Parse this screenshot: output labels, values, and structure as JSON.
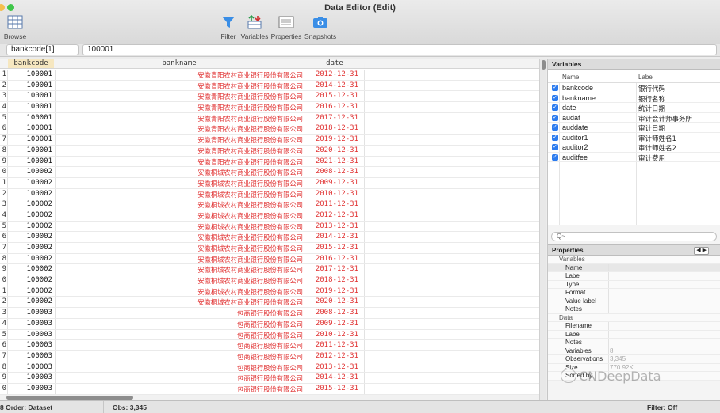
{
  "window": {
    "title": "Data Editor (Edit)"
  },
  "toolbar": {
    "browse": "Browse",
    "filter": "Filter",
    "variables": "Variables",
    "properties": "Properties",
    "snapshots": "Snapshots"
  },
  "cellbar": {
    "ref": "bankcode[1]",
    "value": "100001"
  },
  "grid": {
    "columns": {
      "bankcode": "bankcode",
      "bankname": "bankname",
      "date": "date"
    },
    "rows": [
      {
        "n": "1",
        "code": "100001",
        "name": "安徽青阳农村商业银行股份有限公司",
        "date": "2012-12-31"
      },
      {
        "n": "2",
        "code": "100001",
        "name": "安徽青阳农村商业银行股份有限公司",
        "date": "2014-12-31"
      },
      {
        "n": "3",
        "code": "100001",
        "name": "安徽青阳农村商业银行股份有限公司",
        "date": "2015-12-31"
      },
      {
        "n": "4",
        "code": "100001",
        "name": "安徽青阳农村商业银行股份有限公司",
        "date": "2016-12-31"
      },
      {
        "n": "5",
        "code": "100001",
        "name": "安徽青阳农村商业银行股份有限公司",
        "date": "2017-12-31"
      },
      {
        "n": "6",
        "code": "100001",
        "name": "安徽青阳农村商业银行股份有限公司",
        "date": "2018-12-31"
      },
      {
        "n": "7",
        "code": "100001",
        "name": "安徽青阳农村商业银行股份有限公司",
        "date": "2019-12-31"
      },
      {
        "n": "8",
        "code": "100001",
        "name": "安徽青阳农村商业银行股份有限公司",
        "date": "2020-12-31"
      },
      {
        "n": "9",
        "code": "100001",
        "name": "安徽青阳农村商业银行股份有限公司",
        "date": "2021-12-31"
      },
      {
        "n": "0",
        "code": "100002",
        "name": "安徽桐城农村商业银行股份有限公司",
        "date": "2008-12-31"
      },
      {
        "n": "1",
        "code": "100002",
        "name": "安徽桐城农村商业银行股份有限公司",
        "date": "2009-12-31"
      },
      {
        "n": "2",
        "code": "100002",
        "name": "安徽桐城农村商业银行股份有限公司",
        "date": "2010-12-31"
      },
      {
        "n": "3",
        "code": "100002",
        "name": "安徽桐城农村商业银行股份有限公司",
        "date": "2011-12-31"
      },
      {
        "n": "4",
        "code": "100002",
        "name": "安徽桐城农村商业银行股份有限公司",
        "date": "2012-12-31"
      },
      {
        "n": "5",
        "code": "100002",
        "name": "安徽桐城农村商业银行股份有限公司",
        "date": "2013-12-31"
      },
      {
        "n": "6",
        "code": "100002",
        "name": "安徽桐城农村商业银行股份有限公司",
        "date": "2014-12-31"
      },
      {
        "n": "7",
        "code": "100002",
        "name": "安徽桐城农村商业银行股份有限公司",
        "date": "2015-12-31"
      },
      {
        "n": "8",
        "code": "100002",
        "name": "安徽桐城农村商业银行股份有限公司",
        "date": "2016-12-31"
      },
      {
        "n": "9",
        "code": "100002",
        "name": "安徽桐城农村商业银行股份有限公司",
        "date": "2017-12-31"
      },
      {
        "n": "0",
        "code": "100002",
        "name": "安徽桐城农村商业银行股份有限公司",
        "date": "2018-12-31"
      },
      {
        "n": "1",
        "code": "100002",
        "name": "安徽桐城农村商业银行股份有限公司",
        "date": "2019-12-31"
      },
      {
        "n": "2",
        "code": "100002",
        "name": "安徽桐城农村商业银行股份有限公司",
        "date": "2020-12-31"
      },
      {
        "n": "3",
        "code": "100003",
        "name": "包商银行股份有限公司",
        "date": "2008-12-31"
      },
      {
        "n": "4",
        "code": "100003",
        "name": "包商银行股份有限公司",
        "date": "2009-12-31"
      },
      {
        "n": "5",
        "code": "100003",
        "name": "包商银行股份有限公司",
        "date": "2010-12-31"
      },
      {
        "n": "6",
        "code": "100003",
        "name": "包商银行股份有限公司",
        "date": "2011-12-31"
      },
      {
        "n": "7",
        "code": "100003",
        "name": "包商银行股份有限公司",
        "date": "2012-12-31"
      },
      {
        "n": "8",
        "code": "100003",
        "name": "包商银行股份有限公司",
        "date": "2013-12-31"
      },
      {
        "n": "9",
        "code": "100003",
        "name": "包商银行股份有限公司",
        "date": "2014-12-31"
      },
      {
        "n": "0",
        "code": "100003",
        "name": "包商银行股份有限公司",
        "date": "2015-12-31"
      }
    ]
  },
  "variables_panel": {
    "title": "Variables",
    "col_name": "Name",
    "col_label": "Label",
    "items": [
      {
        "name": "bankcode",
        "label": "银行代码"
      },
      {
        "name": "bankname",
        "label": "银行名称"
      },
      {
        "name": "date",
        "label": "统计日期"
      },
      {
        "name": "audaf",
        "label": "审计会计师事务所"
      },
      {
        "name": "auddate",
        "label": "审计日期"
      },
      {
        "name": "auditor1",
        "label": "审计师姓名1"
      },
      {
        "name": "auditor2",
        "label": "审计师姓名2"
      },
      {
        "name": "auditfee",
        "label": "审计费用"
      }
    ],
    "search_placeholder": "Q~"
  },
  "properties_panel": {
    "title": "Properties",
    "nav": "◀ ▶",
    "variables_section": "Variables",
    "var_props": [
      "Name",
      "Label",
      "Type",
      "Format",
      "Value label",
      "Notes"
    ],
    "data_section": "Data",
    "data_props": [
      {
        "key": "Filename",
        "value": ""
      },
      {
        "key": "Label",
        "value": ""
      },
      {
        "key": "Notes",
        "value": ""
      },
      {
        "key": "Variables",
        "value": "8"
      },
      {
        "key": "Observations",
        "value": "3,345"
      },
      {
        "key": "Size",
        "value": "770.92K"
      },
      {
        "key": "Sorted by",
        "value": ""
      }
    ]
  },
  "status": {
    "order": "8  Order: Dataset",
    "obs": "Obs: 3,345",
    "filter": "Filter: Off"
  },
  "watermark": "CNDeepData"
}
